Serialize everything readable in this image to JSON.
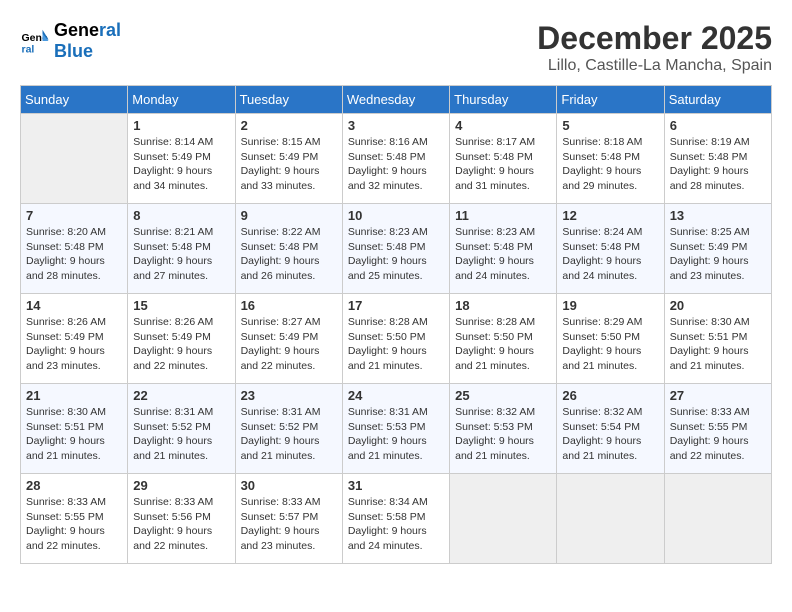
{
  "header": {
    "logo_line1": "General",
    "logo_line2": "Blue",
    "month_title": "December 2025",
    "location": "Lillo, Castille-La Mancha, Spain"
  },
  "days_of_week": [
    "Sunday",
    "Monday",
    "Tuesday",
    "Wednesday",
    "Thursday",
    "Friday",
    "Saturday"
  ],
  "weeks": [
    [
      {
        "day": "",
        "sunrise": "",
        "sunset": "",
        "daylight": ""
      },
      {
        "day": "1",
        "sunrise": "Sunrise: 8:14 AM",
        "sunset": "Sunset: 5:49 PM",
        "daylight": "Daylight: 9 hours and 34 minutes."
      },
      {
        "day": "2",
        "sunrise": "Sunrise: 8:15 AM",
        "sunset": "Sunset: 5:49 PM",
        "daylight": "Daylight: 9 hours and 33 minutes."
      },
      {
        "day": "3",
        "sunrise": "Sunrise: 8:16 AM",
        "sunset": "Sunset: 5:48 PM",
        "daylight": "Daylight: 9 hours and 32 minutes."
      },
      {
        "day": "4",
        "sunrise": "Sunrise: 8:17 AM",
        "sunset": "Sunset: 5:48 PM",
        "daylight": "Daylight: 9 hours and 31 minutes."
      },
      {
        "day": "5",
        "sunrise": "Sunrise: 8:18 AM",
        "sunset": "Sunset: 5:48 PM",
        "daylight": "Daylight: 9 hours and 29 minutes."
      },
      {
        "day": "6",
        "sunrise": "Sunrise: 8:19 AM",
        "sunset": "Sunset: 5:48 PM",
        "daylight": "Daylight: 9 hours and 28 minutes."
      }
    ],
    [
      {
        "day": "7",
        "sunrise": "Sunrise: 8:20 AM",
        "sunset": "Sunset: 5:48 PM",
        "daylight": "Daylight: 9 hours and 28 minutes."
      },
      {
        "day": "8",
        "sunrise": "Sunrise: 8:21 AM",
        "sunset": "Sunset: 5:48 PM",
        "daylight": "Daylight: 9 hours and 27 minutes."
      },
      {
        "day": "9",
        "sunrise": "Sunrise: 8:22 AM",
        "sunset": "Sunset: 5:48 PM",
        "daylight": "Daylight: 9 hours and 26 minutes."
      },
      {
        "day": "10",
        "sunrise": "Sunrise: 8:23 AM",
        "sunset": "Sunset: 5:48 PM",
        "daylight": "Daylight: 9 hours and 25 minutes."
      },
      {
        "day": "11",
        "sunrise": "Sunrise: 8:23 AM",
        "sunset": "Sunset: 5:48 PM",
        "daylight": "Daylight: 9 hours and 24 minutes."
      },
      {
        "day": "12",
        "sunrise": "Sunrise: 8:24 AM",
        "sunset": "Sunset: 5:48 PM",
        "daylight": "Daylight: 9 hours and 24 minutes."
      },
      {
        "day": "13",
        "sunrise": "Sunrise: 8:25 AM",
        "sunset": "Sunset: 5:49 PM",
        "daylight": "Daylight: 9 hours and 23 minutes."
      }
    ],
    [
      {
        "day": "14",
        "sunrise": "Sunrise: 8:26 AM",
        "sunset": "Sunset: 5:49 PM",
        "daylight": "Daylight: 9 hours and 23 minutes."
      },
      {
        "day": "15",
        "sunrise": "Sunrise: 8:26 AM",
        "sunset": "Sunset: 5:49 PM",
        "daylight": "Daylight: 9 hours and 22 minutes."
      },
      {
        "day": "16",
        "sunrise": "Sunrise: 8:27 AM",
        "sunset": "Sunset: 5:49 PM",
        "daylight": "Daylight: 9 hours and 22 minutes."
      },
      {
        "day": "17",
        "sunrise": "Sunrise: 8:28 AM",
        "sunset": "Sunset: 5:50 PM",
        "daylight": "Daylight: 9 hours and 21 minutes."
      },
      {
        "day": "18",
        "sunrise": "Sunrise: 8:28 AM",
        "sunset": "Sunset: 5:50 PM",
        "daylight": "Daylight: 9 hours and 21 minutes."
      },
      {
        "day": "19",
        "sunrise": "Sunrise: 8:29 AM",
        "sunset": "Sunset: 5:50 PM",
        "daylight": "Daylight: 9 hours and 21 minutes."
      },
      {
        "day": "20",
        "sunrise": "Sunrise: 8:30 AM",
        "sunset": "Sunset: 5:51 PM",
        "daylight": "Daylight: 9 hours and 21 minutes."
      }
    ],
    [
      {
        "day": "21",
        "sunrise": "Sunrise: 8:30 AM",
        "sunset": "Sunset: 5:51 PM",
        "daylight": "Daylight: 9 hours and 21 minutes."
      },
      {
        "day": "22",
        "sunrise": "Sunrise: 8:31 AM",
        "sunset": "Sunset: 5:52 PM",
        "daylight": "Daylight: 9 hours and 21 minutes."
      },
      {
        "day": "23",
        "sunrise": "Sunrise: 8:31 AM",
        "sunset": "Sunset: 5:52 PM",
        "daylight": "Daylight: 9 hours and 21 minutes."
      },
      {
        "day": "24",
        "sunrise": "Sunrise: 8:31 AM",
        "sunset": "Sunset: 5:53 PM",
        "daylight": "Daylight: 9 hours and 21 minutes."
      },
      {
        "day": "25",
        "sunrise": "Sunrise: 8:32 AM",
        "sunset": "Sunset: 5:53 PM",
        "daylight": "Daylight: 9 hours and 21 minutes."
      },
      {
        "day": "26",
        "sunrise": "Sunrise: 8:32 AM",
        "sunset": "Sunset: 5:54 PM",
        "daylight": "Daylight: 9 hours and 21 minutes."
      },
      {
        "day": "27",
        "sunrise": "Sunrise: 8:33 AM",
        "sunset": "Sunset: 5:55 PM",
        "daylight": "Daylight: 9 hours and 22 minutes."
      }
    ],
    [
      {
        "day": "28",
        "sunrise": "Sunrise: 8:33 AM",
        "sunset": "Sunset: 5:55 PM",
        "daylight": "Daylight: 9 hours and 22 minutes."
      },
      {
        "day": "29",
        "sunrise": "Sunrise: 8:33 AM",
        "sunset": "Sunset: 5:56 PM",
        "daylight": "Daylight: 9 hours and 22 minutes."
      },
      {
        "day": "30",
        "sunrise": "Sunrise: 8:33 AM",
        "sunset": "Sunset: 5:57 PM",
        "daylight": "Daylight: 9 hours and 23 minutes."
      },
      {
        "day": "31",
        "sunrise": "Sunrise: 8:34 AM",
        "sunset": "Sunset: 5:58 PM",
        "daylight": "Daylight: 9 hours and 24 minutes."
      },
      {
        "day": "",
        "sunrise": "",
        "sunset": "",
        "daylight": ""
      },
      {
        "day": "",
        "sunrise": "",
        "sunset": "",
        "daylight": ""
      },
      {
        "day": "",
        "sunrise": "",
        "sunset": "",
        "daylight": ""
      }
    ]
  ]
}
